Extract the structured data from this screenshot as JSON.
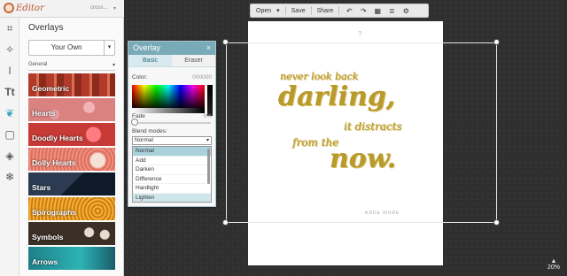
{
  "app": {
    "logo_text": "Editor",
    "user_label": "cross...",
    "user_caret": "▾"
  },
  "tools": [
    {
      "name": "crop-icon",
      "glyph": "⌗"
    },
    {
      "name": "magic-wand-icon",
      "glyph": "✧"
    },
    {
      "name": "brush-icon",
      "glyph": "ǀ"
    },
    {
      "name": "text-icon",
      "glyph": "Tt"
    },
    {
      "name": "butterfly-icon",
      "glyph": "❦"
    },
    {
      "name": "frame-icon",
      "glyph": "▢"
    },
    {
      "name": "texture-icon",
      "glyph": "◈"
    },
    {
      "name": "snowflake-icon",
      "glyph": "❄"
    }
  ],
  "panel": {
    "title": "Overlays",
    "category": "Your Own",
    "category_caret": "▾",
    "subcategory": "General",
    "subcategory_caret": "▾",
    "tiles": [
      "Geometric",
      "Hearts",
      "Doodly Hearts",
      "Dolly Hearts",
      "Stars",
      "Spirographs",
      "Symbols",
      "Arrows"
    ]
  },
  "filebar": {
    "open_label": "Open",
    "open_caret": "▾",
    "save_label": "Save",
    "share_label": "Share",
    "icons": {
      "undo": "↶",
      "redo": "↷",
      "image": "▦",
      "layers": "≣",
      "settings": "⚙"
    }
  },
  "canvas": {
    "rotate_glyph": "?",
    "quote_lines": [
      "never look back",
      "darling,",
      "it distracts",
      "from the",
      "now."
    ],
    "attribution": "edna mode",
    "zoom_value": "20%",
    "zoom_icon": "▲"
  },
  "dialog": {
    "title": "Overlay",
    "close": "×",
    "tabs": [
      "Basic",
      "Eraser"
    ],
    "color_label": "Color:",
    "color_value": "000000",
    "fade_label": "Fade",
    "fade_value": "0%",
    "blend_label": "Blend modes:",
    "blend_selected": "Normal",
    "blend_caret": "▾",
    "blend_options": [
      "Normal",
      "Add",
      "Darken",
      "Difference",
      "Hardlight",
      "Lighten"
    ]
  },
  "colors": {
    "accent": "#79aab7",
    "gold": "#b99a2d",
    "toolbar_active": "#3aa4bf"
  }
}
